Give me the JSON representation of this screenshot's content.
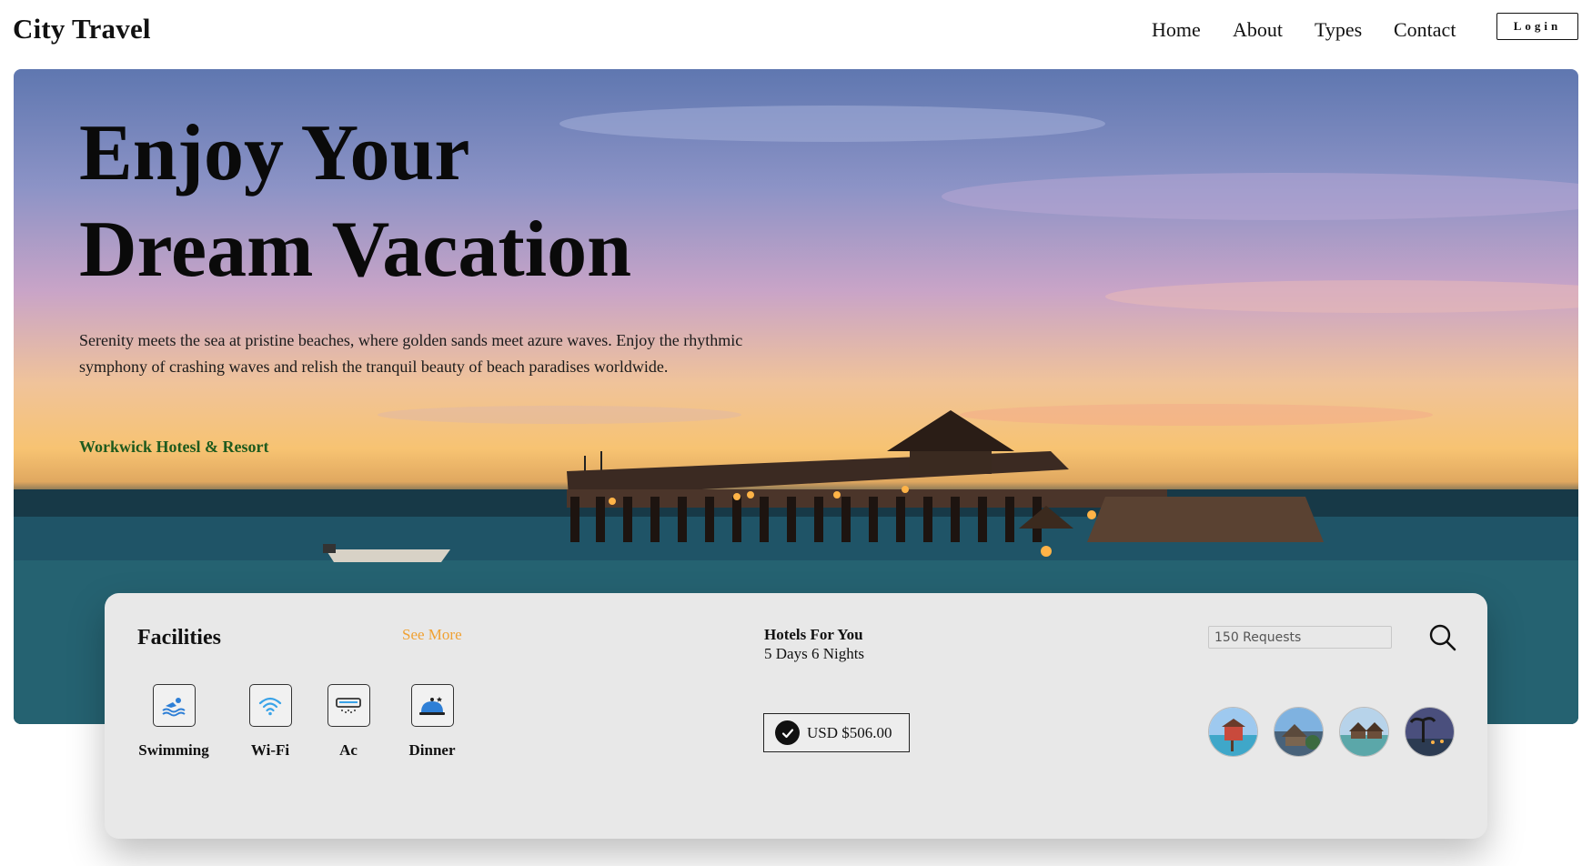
{
  "header": {
    "brand": "City Travel",
    "nav": {
      "home": "Home",
      "about": "About",
      "types": "Types",
      "contact": "Contact"
    },
    "login_label": "Login"
  },
  "hero": {
    "title_line1": "Enjoy Your",
    "title_line2": "Dream Vacation",
    "description": "Serenity meets the sea at pristine beaches, where golden sands meet azure waves. Enjoy the rhythmic symphony of crashing waves and relish the tranquil beauty of beach paradises worldwide.",
    "link_label": "Workwick Hotesl & Resort"
  },
  "facilities": {
    "title": "Facilities",
    "see_more": "See More",
    "items": [
      {
        "label": "Swimming",
        "icon": "swimming-icon"
      },
      {
        "label": "Wi-Fi",
        "icon": "wifi-icon"
      },
      {
        "label": "Ac",
        "icon": "air-conditioner-icon"
      },
      {
        "label": "Dinner",
        "icon": "dinner-cloche-icon"
      }
    ]
  },
  "hotels": {
    "title": "Hotels For You",
    "duration": "5 Days 6 Nights",
    "price": "USD $506.00"
  },
  "search": {
    "requests_value": "150 Requests",
    "icon": "search-icon"
  },
  "thumbnails": [
    "hotel-thumbnail-1",
    "hotel-thumbnail-2",
    "hotel-thumbnail-3",
    "hotel-thumbnail-4"
  ],
  "colors": {
    "see_more": "#f0a132",
    "resort_link": "#1e5a1e",
    "card_bg": "#e8e8e8",
    "wifi_blue": "#3aa3e8"
  }
}
